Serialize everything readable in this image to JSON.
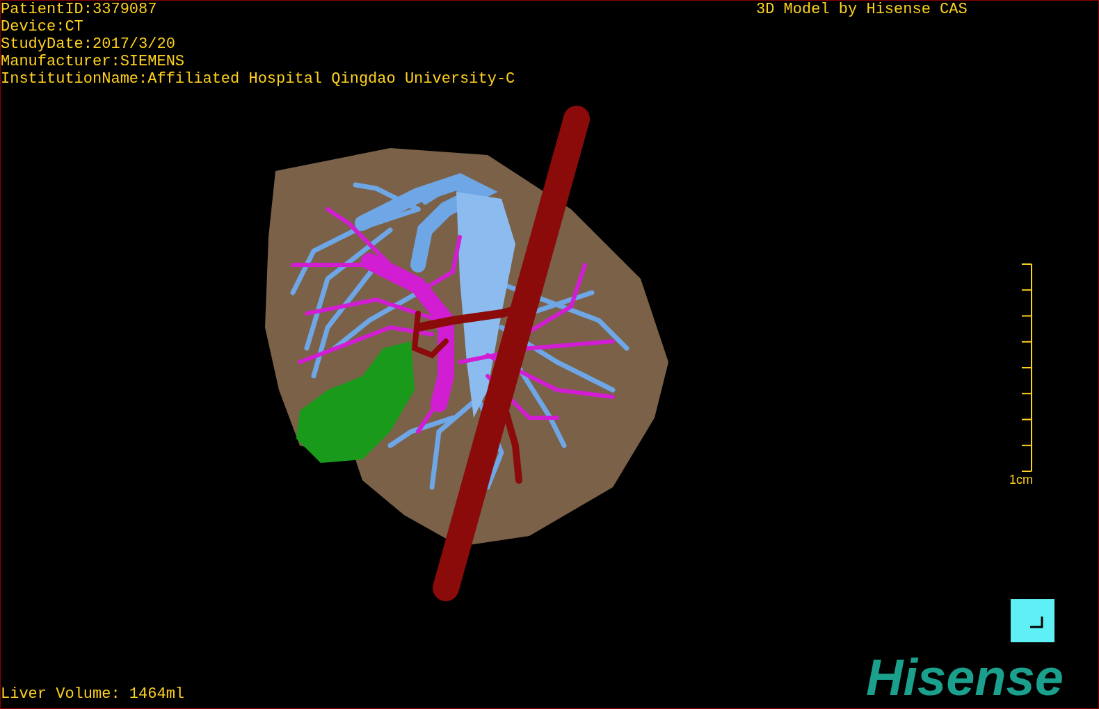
{
  "overlay": {
    "info_lines": [
      "PatientID:3379087",
      "Device:CT",
      "StudyDate:2017/3/20",
      "Manufacturer:SIEMENS",
      "InstitutionName:Affiliated Hospital Qingdao University-C"
    ],
    "title": "3D Model by Hisense CAS",
    "scale_label": "1cm",
    "volume": "Liver Volume: 1464ml",
    "logo": "Hisense"
  }
}
